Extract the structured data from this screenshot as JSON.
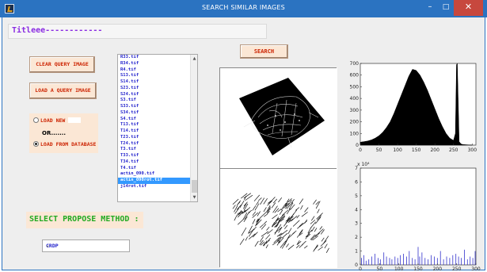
{
  "window": {
    "title": "SEARCH SIMILAR IMAGES",
    "minimize_glyph": "–",
    "maximize_glyph": "□",
    "close_glyph": "✕",
    "app_icon": "matlab-icon"
  },
  "title_field": {
    "text": "Titleee------------"
  },
  "buttons": {
    "clear_query": "CLEAR QUERY IMAGE",
    "load_query": "LOAD A QUERY IMAGE",
    "search": "SEARCH"
  },
  "source_panel": {
    "load_new": "LOAD NEW",
    "or_text": "OR.......",
    "load_from_database": "LOAD FROM DATABASE",
    "selected": "LOAD FROM DATABASE"
  },
  "file_list": {
    "items": [
      "R33.tif",
      "R34.tif",
      "R4.tif",
      "S13.tif",
      "S14.tif",
      "S23.tif",
      "S24.tif",
      "S3.tif",
      "S33.tif",
      "S34.tif",
      "S4.tif",
      "T13.tif",
      "T14.tif",
      "T23.tif",
      "T24.tif",
      "T3.tif",
      "T33.tif",
      "T34.tif",
      "T4.tif",
      "actin_090.tif",
      "actin_090rot.tif",
      "j14rot.tif"
    ],
    "selected": "actin_090rot.tif"
  },
  "method": {
    "label": "SELECT PROPOSE METHOD :",
    "selected": "CRDP"
  },
  "colors": {
    "titlebar": "#2b73c1",
    "close_button": "#c7483e",
    "button_face": "#fbe7d5",
    "button_text": "#cc2200",
    "list_text": "#2222cc",
    "list_selection": "#3399ff",
    "method_text": "#22aa22",
    "title_text": "#8a2be2"
  },
  "chart_data": [
    {
      "type": "area",
      "x_ticks": [
        "0",
        "50",
        "100",
        "150",
        "200",
        "250",
        "300"
      ],
      "y_ticks": [
        "0",
        "100",
        "200",
        "300",
        "400",
        "500",
        "600",
        "700"
      ],
      "xlim": [
        0,
        310
      ],
      "ylim": [
        0,
        700
      ],
      "grid": false,
      "x": [
        0,
        10,
        20,
        30,
        40,
        50,
        60,
        70,
        80,
        90,
        100,
        110,
        120,
        130,
        140,
        150,
        160,
        170,
        180,
        190,
        200,
        210,
        220,
        230,
        240,
        250,
        255,
        258,
        260,
        263,
        265,
        270,
        275,
        300
      ],
      "y": [
        25,
        30,
        35,
        45,
        60,
        80,
        110,
        150,
        200,
        270,
        350,
        430,
        510,
        590,
        650,
        640,
        600,
        540,
        470,
        390,
        310,
        230,
        160,
        100,
        60,
        40,
        100,
        690,
        700,
        300,
        30,
        10,
        5,
        0
      ]
    },
    {
      "type": "bar",
      "x_ticks": [
        "0",
        "50",
        "100",
        "150",
        "200",
        "250",
        "300"
      ],
      "y_ticks": [
        "0",
        "1",
        "2",
        "3",
        "4",
        "5",
        "6",
        "7"
      ],
      "y_multiplier": "x 10⁴",
      "xlim": [
        0,
        300
      ],
      "ylim": [
        0,
        7
      ],
      "grid": false,
      "x": [
        3,
        9,
        15,
        22,
        30,
        38,
        46,
        52,
        61,
        68,
        76,
        82,
        90,
        97,
        104,
        112,
        120,
        127,
        135,
        142,
        150,
        154,
        160,
        168,
        176,
        184,
        192,
        200,
        208,
        216,
        224,
        232,
        240,
        248,
        255,
        262,
        270,
        278,
        285,
        292,
        298
      ],
      "values": [
        0.5,
        0.7,
        0.3,
        0.4,
        0.6,
        0.8,
        0.5,
        0.4,
        0.9,
        0.6,
        0.5,
        0.4,
        0.6,
        0.5,
        0.7,
        0.8,
        0.6,
        1.0,
        0.5,
        0.4,
        1.3,
        0.6,
        0.9,
        0.5,
        0.4,
        0.7,
        0.6,
        0.5,
        1.0,
        0.4,
        0.6,
        0.5,
        0.7,
        0.8,
        0.6,
        0.5,
        1.1,
        0.4,
        0.6,
        0.5,
        1.0
      ]
    }
  ]
}
